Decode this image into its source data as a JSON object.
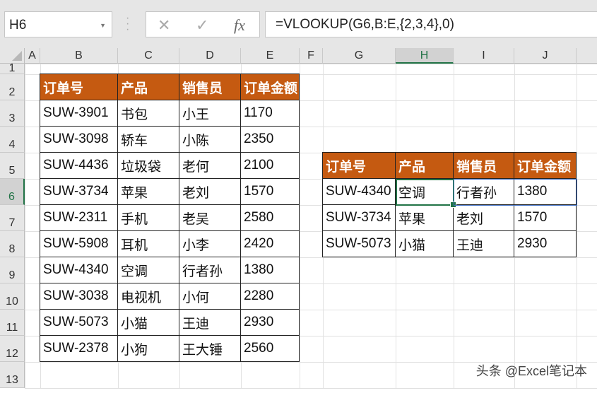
{
  "name_box": "H6",
  "formula_bar": {
    "cancel": "✕",
    "enter": "✓",
    "fx": "fx",
    "formula": "=VLOOKUP(G6,B:E,{2,3,4},0)"
  },
  "columns": [
    "A",
    "B",
    "C",
    "D",
    "E",
    "F",
    "G",
    "H",
    "I",
    "J"
  ],
  "rows": [
    "1",
    "2",
    "3",
    "4",
    "5",
    "6",
    "7",
    "8",
    "9",
    "10",
    "11",
    "12",
    "13"
  ],
  "selected_cell": "H6",
  "table1": {
    "headers": [
      "订单号",
      "产品",
      "销售员",
      "订单金额"
    ],
    "rows": [
      [
        "SUW-3901",
        "书包",
        "小王",
        "1170"
      ],
      [
        "SUW-3098",
        "轿车",
        "小陈",
        "2350"
      ],
      [
        "SUW-4436",
        "垃圾袋",
        "老何",
        "2100"
      ],
      [
        "SUW-3734",
        "苹果",
        "老刘",
        "1570"
      ],
      [
        "SUW-2311",
        "手机",
        "老吴",
        "2580"
      ],
      [
        "SUW-5908",
        "耳机",
        "小李",
        "2420"
      ],
      [
        "SUW-4340",
        "空调",
        "行者孙",
        "1380"
      ],
      [
        "SUW-3038",
        "电视机",
        "小何",
        "2280"
      ],
      [
        "SUW-5073",
        "小猫",
        "王迪",
        "2930"
      ],
      [
        "SUW-2378",
        "小狗",
        "王大锤",
        "2560"
      ]
    ]
  },
  "table2": {
    "headers": [
      "订单号",
      "产品",
      "销售员",
      "订单金额"
    ],
    "rows": [
      [
        "SUW-4340",
        "空调",
        "行者孙",
        "1380"
      ],
      [
        "SUW-3734",
        "苹果",
        "老刘",
        "1570"
      ],
      [
        "SUW-5073",
        "小猫",
        "王迪",
        "2930"
      ]
    ]
  },
  "watermark": "头条 @Excel笔记本",
  "colors": {
    "header_fill": "#C55A11",
    "selection": "#217346"
  }
}
